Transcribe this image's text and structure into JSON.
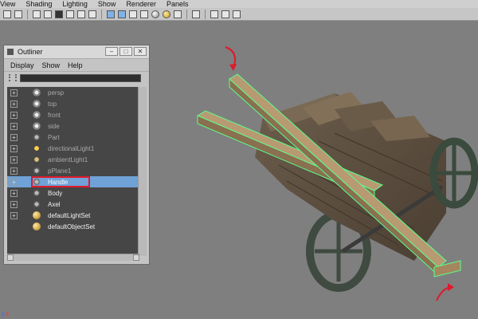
{
  "menubar": {
    "items": [
      "View",
      "Shading",
      "Lighting",
      "Show",
      "Renderer",
      "Panels"
    ]
  },
  "toolbar": {
    "icons": [
      "camera-icon",
      "grid-icon",
      "film-gate-icon",
      "image-plane-icon",
      "resolution-icon",
      "safe-action-icon",
      "wireframe-icon",
      "smooth-shaded-icon",
      "textured-icon",
      "lighting-icon",
      "shadow-icon",
      "isolate-icon",
      "xray-icon",
      "hud-icon"
    ]
  },
  "outliner": {
    "title": "Outliner",
    "menu": [
      "Display",
      "Show",
      "Help"
    ],
    "window_buttons": [
      "–",
      "□",
      "✕"
    ],
    "items": [
      {
        "label": "persp",
        "icon": "camera-icon",
        "expander": true,
        "bright": false
      },
      {
        "label": "top",
        "icon": "camera-icon",
        "expander": true,
        "bright": false
      },
      {
        "label": "front",
        "icon": "camera-icon",
        "expander": true,
        "bright": false
      },
      {
        "label": "side",
        "icon": "camera-icon",
        "expander": true,
        "bright": false
      },
      {
        "label": "Part",
        "icon": "mesh-icon",
        "expander": true,
        "bright": false
      },
      {
        "label": "directionalLight1",
        "icon": "directional-light-icon",
        "expander": true,
        "bright": false
      },
      {
        "label": "ambientLight1",
        "icon": "ambient-light-icon",
        "expander": true,
        "bright": false
      },
      {
        "label": "pPlane1",
        "icon": "mesh-icon",
        "expander": true,
        "bright": false
      },
      {
        "label": "Handle",
        "icon": "mesh-icon",
        "expander": true,
        "bright": true,
        "selected": true
      },
      {
        "label": "Body",
        "icon": "mesh-icon",
        "expander": true,
        "bright": true
      },
      {
        "label": "Axel",
        "icon": "mesh-icon",
        "expander": true,
        "bright": true
      },
      {
        "label": "defaultLightSet",
        "icon": "set-icon",
        "expander": true,
        "bright": true
      },
      {
        "label": "defaultObjectSet",
        "icon": "set-icon",
        "expander": false,
        "bright": true
      }
    ]
  },
  "axis_indicator": {
    "z": "z",
    "x": "x"
  },
  "colors": {
    "selection_highlight": "#6fa2d6",
    "annotation_red": "#e0192b",
    "selected_wire": "#5aff8a"
  }
}
